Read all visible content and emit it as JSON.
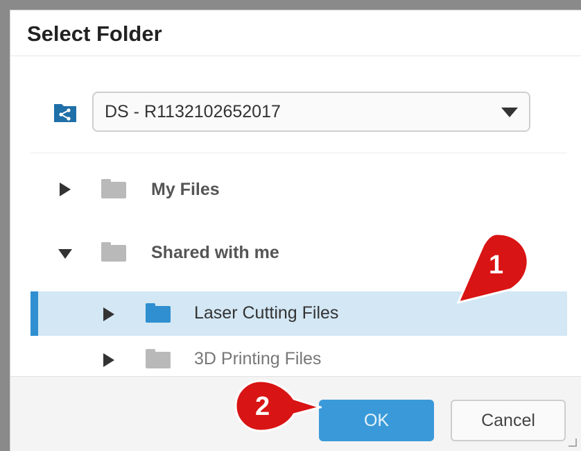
{
  "dialog": {
    "title": "Select Folder"
  },
  "location": {
    "icon": "shared-drive-icon",
    "selected": "DS - R1132102652017"
  },
  "tree": [
    {
      "label": "My Files",
      "expanded": false,
      "icon": "folder-icon",
      "state": "normal"
    },
    {
      "label": "Shared with me",
      "expanded": true,
      "icon": "folder-icon",
      "state": "normal"
    },
    {
      "label": "Laser Cutting Files",
      "expanded": false,
      "icon": "folder-icon",
      "state": "selected"
    },
    {
      "label": "3D Printing Files",
      "expanded": false,
      "icon": "folder-icon",
      "state": "dim"
    }
  ],
  "buttons": {
    "ok": "OK",
    "cancel": "Cancel"
  },
  "callouts": {
    "step1": "1",
    "step2": "2"
  },
  "colors": {
    "accent": "#3a9ad9",
    "selected_row": "#d3e7f4",
    "callout": "#d91414"
  }
}
